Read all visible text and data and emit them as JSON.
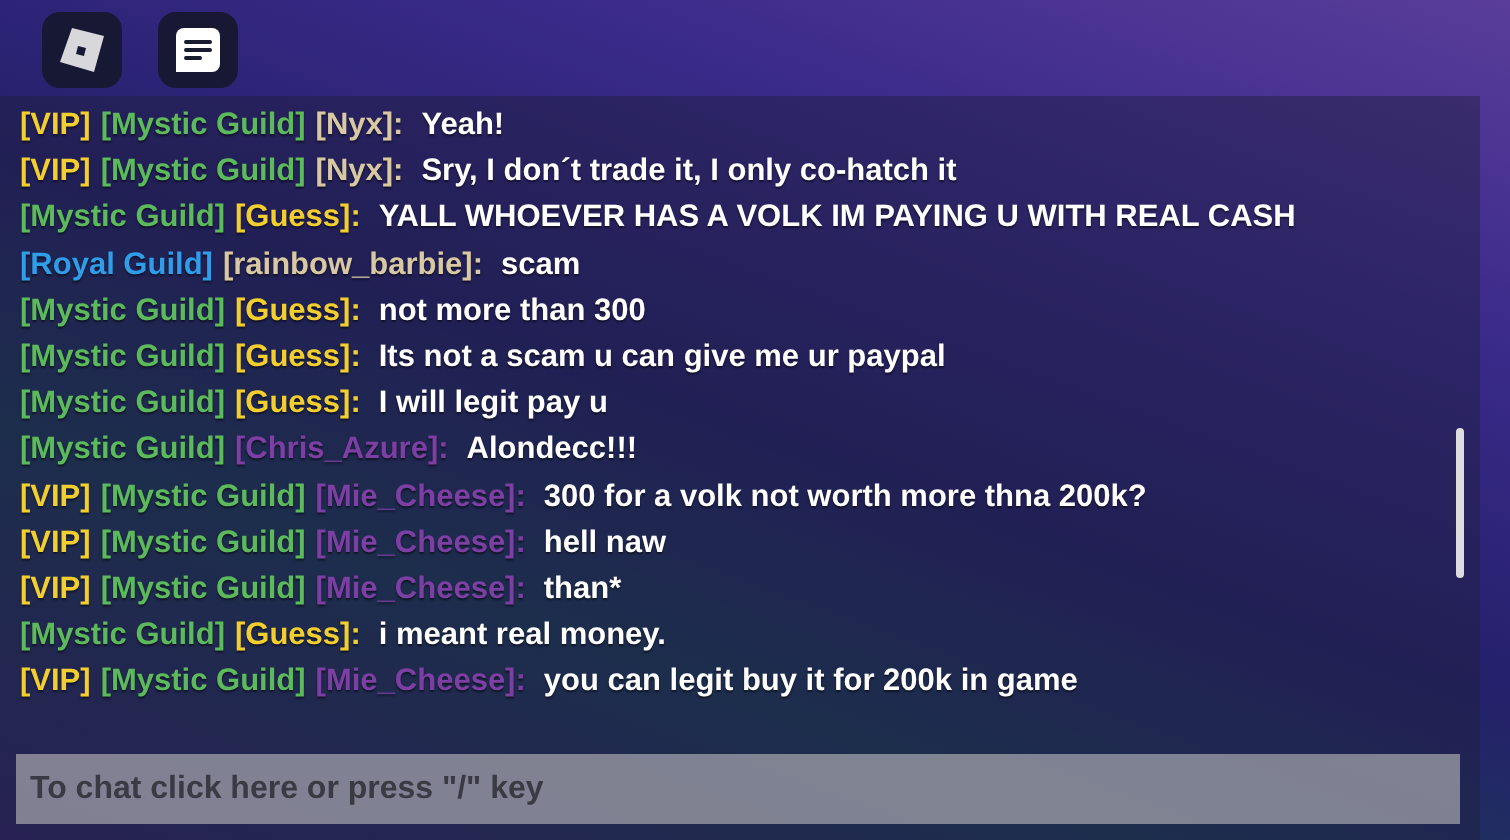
{
  "chat": {
    "messages": [
      {
        "tags": [
          {
            "text": "[VIP]",
            "color": "#f2cf2e"
          },
          {
            "text": "[Mystic Guild]",
            "color": "#5cba5c"
          }
        ],
        "author": {
          "text": "[Nyx]:",
          "color": "#d9c9a3"
        },
        "text": "Yeah!"
      },
      {
        "tags": [
          {
            "text": "[VIP]",
            "color": "#f2cf2e"
          },
          {
            "text": "[Mystic Guild]",
            "color": "#5cba5c"
          }
        ],
        "author": {
          "text": "[Nyx]:",
          "color": "#d9c9a3"
        },
        "text": "Sry, I don´t trade it, I only co-hatch it"
      },
      {
        "tags": [
          {
            "text": "[Mystic Guild]",
            "color": "#5cba5c"
          }
        ],
        "author": {
          "text": "[Guess]:",
          "color": "#f2cf2e"
        },
        "text": "YALL WHOEVER HAS A VOLK IM PAYING U WITH REAL CASH"
      },
      {
        "tags": [
          {
            "text": "[Royal Guild]",
            "color": "#2f9de8"
          }
        ],
        "author": {
          "text": "[rainbow_barbie]:",
          "color": "#d9c9a3"
        },
        "text": "scam"
      },
      {
        "tags": [
          {
            "text": "[Mystic Guild]",
            "color": "#5cba5c"
          }
        ],
        "author": {
          "text": "[Guess]:",
          "color": "#f2cf2e"
        },
        "text": "not more than 300"
      },
      {
        "tags": [
          {
            "text": "[Mystic Guild]",
            "color": "#5cba5c"
          }
        ],
        "author": {
          "text": "[Guess]:",
          "color": "#f2cf2e"
        },
        "text": "Its not a scam u can give me ur paypal"
      },
      {
        "tags": [
          {
            "text": "[Mystic Guild]",
            "color": "#5cba5c"
          }
        ],
        "author": {
          "text": "[Guess]:",
          "color": "#f2cf2e"
        },
        "text": "I will legit pay u"
      },
      {
        "tags": [
          {
            "text": "[Mystic Guild]",
            "color": "#5cba5c"
          }
        ],
        "author": {
          "text": "[Chris_Azure]:",
          "color": "#7d3fa3"
        },
        "text": "Alondecc!!!"
      },
      {
        "tags": [
          {
            "text": "[VIP]",
            "color": "#f2cf2e"
          },
          {
            "text": "[Mystic Guild]",
            "color": "#5cba5c"
          }
        ],
        "author": {
          "text": "[Mie_Cheese]:",
          "color": "#7d3fa3"
        },
        "text": "300 for a volk not worth more thna 200k?"
      },
      {
        "tags": [
          {
            "text": "[VIP]",
            "color": "#f2cf2e"
          },
          {
            "text": "[Mystic Guild]",
            "color": "#5cba5c"
          }
        ],
        "author": {
          "text": "[Mie_Cheese]:",
          "color": "#7d3fa3"
        },
        "text": "hell naw"
      },
      {
        "tags": [
          {
            "text": "[VIP]",
            "color": "#f2cf2e"
          },
          {
            "text": "[Mystic Guild]",
            "color": "#5cba5c"
          }
        ],
        "author": {
          "text": "[Mie_Cheese]:",
          "color": "#7d3fa3"
        },
        "text": "than*"
      },
      {
        "tags": [
          {
            "text": "[Mystic Guild]",
            "color": "#5cba5c"
          }
        ],
        "author": {
          "text": "[Guess]:",
          "color": "#f2cf2e"
        },
        "text": "i meant real money."
      },
      {
        "tags": [
          {
            "text": "[VIP]",
            "color": "#f2cf2e"
          },
          {
            "text": "[Mystic Guild]",
            "color": "#5cba5c"
          }
        ],
        "author": {
          "text": "[Mie_Cheese]:",
          "color": "#7d3fa3"
        },
        "text": "you can legit buy it for 200k in game"
      }
    ],
    "input": {
      "placeholder": "To chat click here or press \"/\" key"
    }
  }
}
